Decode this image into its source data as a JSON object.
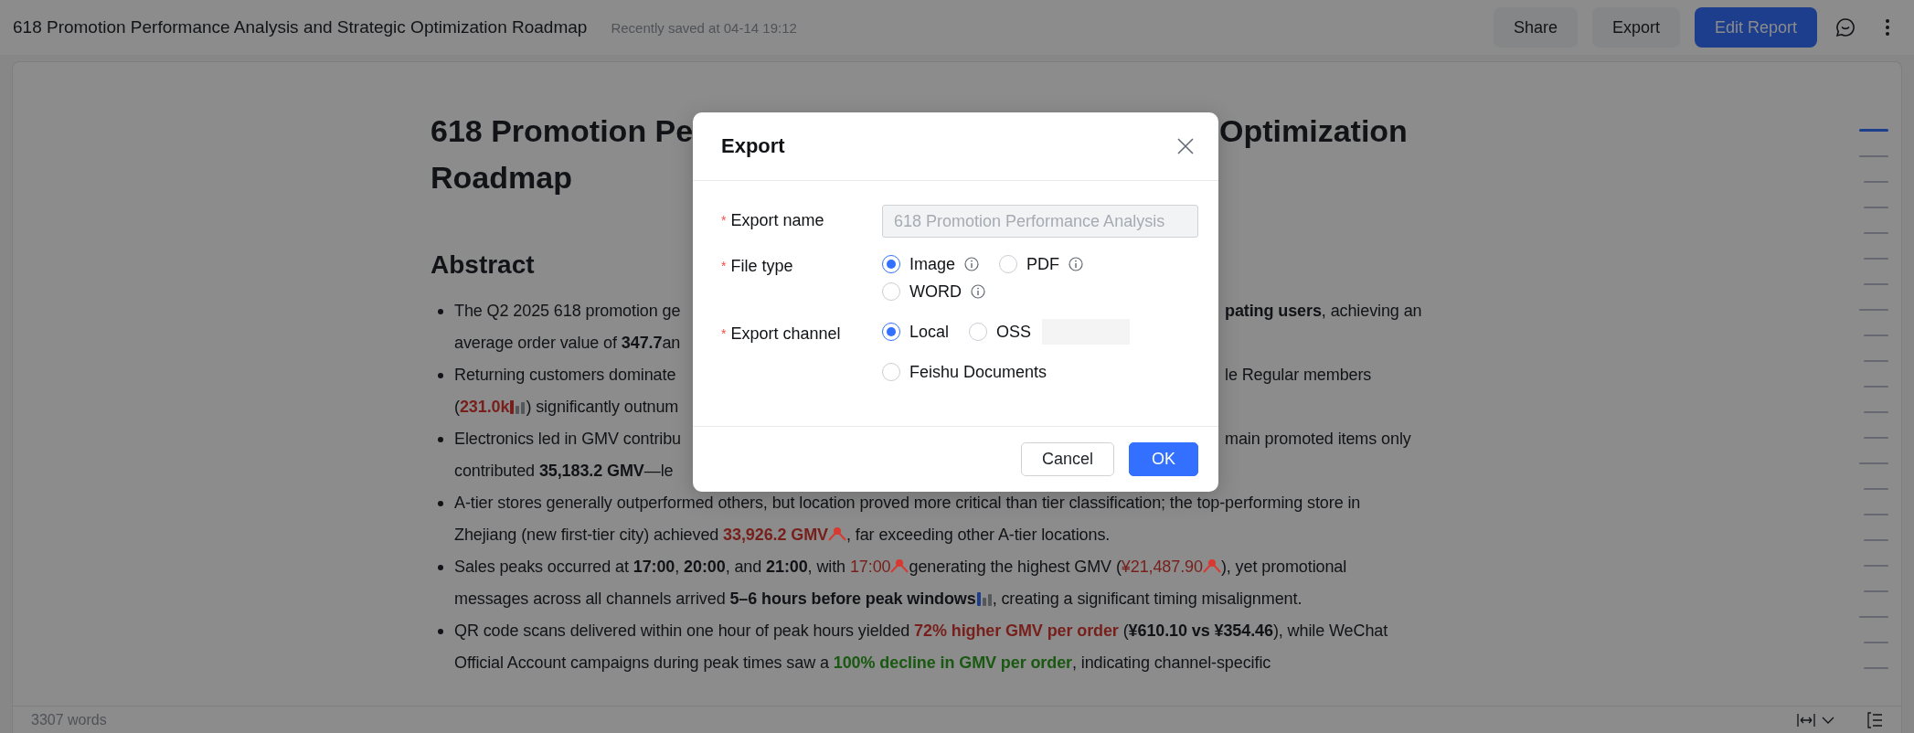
{
  "header": {
    "title": "618 Promotion Performance Analysis and Strategic Optimization Roadmap",
    "save_status": "Recently saved at 04-14 19:12",
    "buttons": [
      {
        "label": "Share",
        "kind": "secondary"
      },
      {
        "label": "Export",
        "kind": "secondary"
      },
      {
        "label": "Edit Report",
        "kind": "primary"
      }
    ]
  },
  "document": {
    "title_left": "618 Promotion Pe",
    "title_right": "Optimization",
    "title_line2": "Roadmap",
    "section": "Abstract",
    "bullets": [
      {
        "kind": "split",
        "lines": [
          {
            "left": [
              {
                "kind": "text",
                "text": "The Q2 2025 618 promotion ge"
              }
            ],
            "right": [
              {
                "kind": "text",
                "text": "**pating users**, achieving an"
              }
            ]
          },
          {
            "left": [
              {
                "kind": "text",
                "text": "average order value of **347.7**an"
              }
            ]
          }
        ]
      },
      {
        "kind": "split",
        "lines": [
          {
            "left": [
              {
                "kind": "text",
                "text": "Returning customers dominate"
              }
            ],
            "right": [
              {
                "kind": "text",
                "text": "le Regular members"
              }
            ]
          },
          {
            "left": [
              {
                "kind": "text",
                "text": "("
              },
              {
                "kind": "text",
                "text": "**231.0k**",
                "color": "#771f1b"
              },
              {
                "kind": "bars",
                "color": "#771f1b"
              },
              {
                "kind": "text",
                "text": ") significantly outnum"
              }
            ]
          }
        ]
      },
      {
        "kind": "split",
        "lines": [
          {
            "left": [
              {
                "kind": "text",
                "text": "Electronics led in GMV contribu"
              }
            ],
            "right": [
              {
                "kind": "text",
                "text": "main promoted items only"
              }
            ]
          },
          {
            "left": [
              {
                "kind": "text",
                "text": "contributed **35,183.2 GMV**—le"
              }
            ]
          }
        ]
      },
      {
        "kind": "flow",
        "segments": [
          {
            "kind": "text",
            "text": "A-tier stores generally outperformed others, but location proved more critical than tier classification; the top-performing store in Zhejiang (new first-tier city) achieved "
          },
          {
            "kind": "text",
            "text": "**33,926.2 GMV**",
            "color": "#771f1b"
          },
          {
            "kind": "peak"
          },
          {
            "kind": "text",
            "text": ", far exceeding other A-tier locations."
          }
        ]
      },
      {
        "kind": "flow",
        "segments": [
          {
            "kind": "text",
            "text": "Sales peaks occurred at **17:00**, **20:00**, and **21:00**, with "
          },
          {
            "kind": "text",
            "text": "17:00",
            "color": "#771f1b"
          },
          {
            "kind": "peak"
          },
          {
            "kind": "text",
            "text": "generating the highest GMV ("
          },
          {
            "kind": "text",
            "text": "¥21,487.90",
            "color": "#771f1b"
          },
          {
            "kind": "peak"
          },
          {
            "kind": "text",
            "text": "), yet promotional messages across all channels arrived **5–6 hours before peak windows**"
          },
          {
            "kind": "bars",
            "color": "#1c3e8c"
          },
          {
            "kind": "text",
            "text": ", creating a significant timing misalignment."
          }
        ]
      },
      {
        "kind": "flow",
        "segments": [
          {
            "kind": "text",
            "text": "QR code scans delivered within one hour of peak hours yielded "
          },
          {
            "kind": "text",
            "text": "**72% higher GMV per order**",
            "color": "#771f1b"
          },
          {
            "kind": "text",
            "text": " (**¥610.10 vs ¥354.46**), while WeChat Official Account campaigns during peak times saw a "
          },
          {
            "kind": "text",
            "text": "**100% decline in GMV per order**",
            "color": "#195911"
          },
          {
            "kind": "text",
            "text": ", indicating channel-specific"
          }
        ]
      }
    ]
  },
  "outline": [
    {
      "selected": true
    },
    {
      "selected": false,
      "children": [
        {
          "selected": false
        },
        {
          "selected": false
        },
        {
          "selected": false
        },
        {
          "selected": false
        },
        {
          "selected": false
        }
      ]
    },
    {
      "selected": false,
      "children": [
        {
          "selected": false
        },
        {
          "selected": false
        },
        {
          "selected": false
        },
        {
          "selected": false
        },
        {
          "selected": false
        }
      ]
    },
    {
      "selected": false,
      "children": [
        {
          "selected": false
        },
        {
          "selected": false
        },
        {
          "selected": false
        },
        {
          "selected": false
        },
        {
          "selected": false
        }
      ]
    },
    {
      "selected": false,
      "children": [
        {
          "selected": false
        },
        {
          "selected": false
        }
      ]
    }
  ],
  "status_bar": {
    "word_count": "3307 words"
  },
  "dialog": {
    "title": "Export",
    "fields": [
      {
        "kind": "input",
        "label": "Export name",
        "required_mark": "*",
        "placeholder": "618 Promotion Performance Analysis"
      },
      {
        "kind": "radio",
        "label": "File type",
        "required_mark": "*",
        "options": [
          {
            "label": "Image",
            "selected": true,
            "info": true
          },
          {
            "label": "PDF",
            "selected": false,
            "info": true
          },
          {
            "label": "WORD",
            "selected": false,
            "info": true
          }
        ]
      },
      {
        "kind": "radio",
        "label": "Export channel",
        "required_mark": "*",
        "options": [
          {
            "label": "Local",
            "selected": true,
            "info": false
          },
          {
            "label": "OSS",
            "selected": false,
            "info": false,
            "redacted": true
          },
          {
            "label": "Feishu Documents",
            "selected": false,
            "info": false
          }
        ]
      }
    ],
    "buttons": [
      {
        "label": "Cancel",
        "kind": "secondary"
      },
      {
        "label": "OK",
        "kind": "primary"
      }
    ]
  }
}
